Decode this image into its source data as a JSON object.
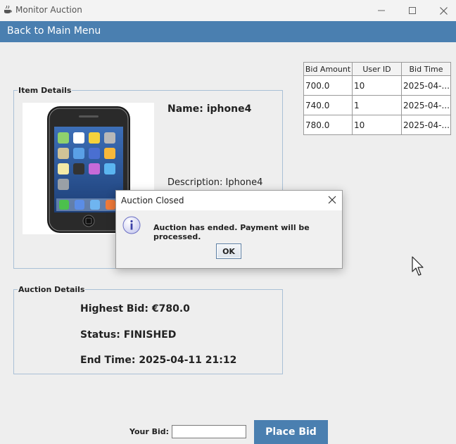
{
  "window": {
    "title": "Monitor Auction",
    "icons": {
      "app": "java-app-icon",
      "minimize": "minimize-icon",
      "maximize": "maximize-icon",
      "close": "close-icon"
    }
  },
  "menu": {
    "back_label": "Back to Main Menu"
  },
  "colors": {
    "accent": "#4a7fb0",
    "border": "#a9c0d6",
    "background": "#eeeeee"
  },
  "item_details": {
    "legend": "Item Details",
    "name": "Name: iphone4",
    "description": "Description: Iphone4",
    "image_icon": "iphone-image"
  },
  "auction_details": {
    "legend": "Auction Details",
    "highest_bid": "Highest Bid: €780.0",
    "status": "Status: FINISHED",
    "end_time": "End Time: 2025-04-11 21:12"
  },
  "bids_table": {
    "columns": [
      "Bid Amount",
      "User ID",
      "Bid Time"
    ],
    "rows": [
      [
        "700.0",
        "10",
        "2025-04-..."
      ],
      [
        "740.0",
        "1",
        "2025-04-..."
      ],
      [
        "780.0",
        "10",
        "2025-04-..."
      ]
    ]
  },
  "bid_form": {
    "label": "Your Bid:",
    "value": "",
    "button_label": "Place Bid"
  },
  "dialog": {
    "title": "Auction Closed",
    "message": "Auction has ended. Payment will be processed.",
    "ok_label": "OK",
    "icon": "info-icon"
  }
}
